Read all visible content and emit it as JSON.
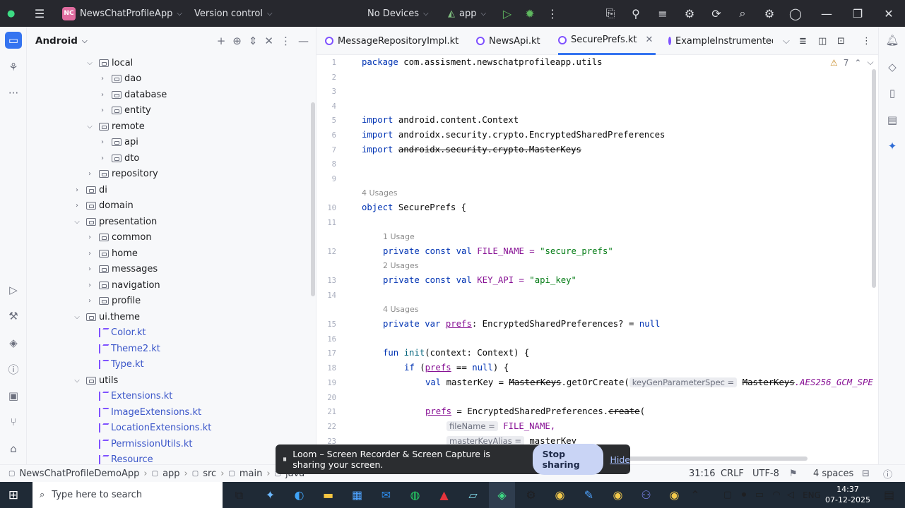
{
  "titlebar": {
    "project_badge": "NC",
    "project_name": "NewsChatProfileApp",
    "vcs": "Version control",
    "devices": "No Devices",
    "run_config": "app"
  },
  "project_panel": {
    "view_mode": "Android",
    "tree": [
      {
        "label": "local",
        "kind": "folder",
        "indent": 2,
        "state": "open",
        "row": 0
      },
      {
        "label": "dao",
        "kind": "folder",
        "indent": 3,
        "state": "closed",
        "row": 1
      },
      {
        "label": "database",
        "kind": "folder",
        "indent": 3,
        "state": "closed",
        "row": 2
      },
      {
        "label": "entity",
        "kind": "folder",
        "indent": 3,
        "state": "closed",
        "row": 3
      },
      {
        "label": "remote",
        "kind": "folder",
        "indent": 2,
        "state": "open",
        "row": 4
      },
      {
        "label": "api",
        "kind": "folder",
        "indent": 3,
        "state": "closed",
        "row": 5
      },
      {
        "label": "dto",
        "kind": "folder",
        "indent": 3,
        "state": "closed",
        "row": 6
      },
      {
        "label": "repository",
        "kind": "folder",
        "indent": 2,
        "state": "closed",
        "row": 7
      },
      {
        "label": "di",
        "kind": "folder",
        "indent": 1,
        "state": "closed",
        "row": 8
      },
      {
        "label": "domain",
        "kind": "folder",
        "indent": 1,
        "state": "closed",
        "row": 9
      },
      {
        "label": "presentation",
        "kind": "folder",
        "indent": 1,
        "state": "open",
        "row": 10
      },
      {
        "label": "common",
        "kind": "folder",
        "indent": 2,
        "state": "closed",
        "row": 11
      },
      {
        "label": "home",
        "kind": "folder",
        "indent": 2,
        "state": "closed",
        "row": 12
      },
      {
        "label": "messages",
        "kind": "folder",
        "indent": 2,
        "state": "closed",
        "row": 13
      },
      {
        "label": "navigation",
        "kind": "folder",
        "indent": 2,
        "state": "closed",
        "row": 14
      },
      {
        "label": "profile",
        "kind": "folder",
        "indent": 2,
        "state": "closed",
        "row": 15
      },
      {
        "label": "ui.theme",
        "kind": "folder",
        "indent": 1,
        "state": "open",
        "row": 16
      },
      {
        "label": "Color.kt",
        "kind": "kotlin",
        "indent": 2,
        "state": "none",
        "row": 17
      },
      {
        "label": "Theme2.kt",
        "kind": "kotlin",
        "indent": 2,
        "state": "none",
        "row": 18
      },
      {
        "label": "Type.kt",
        "kind": "kotlin",
        "indent": 2,
        "state": "none",
        "row": 19
      },
      {
        "label": "utils",
        "kind": "folder",
        "indent": 1,
        "state": "open",
        "row": 20
      },
      {
        "label": "Extensions.kt",
        "kind": "kotlin",
        "indent": 2,
        "state": "none",
        "row": 21
      },
      {
        "label": "ImageExtensions.kt",
        "kind": "kotlin",
        "indent": 2,
        "state": "none",
        "row": 22
      },
      {
        "label": "LocationExtensions.kt",
        "kind": "kotlin",
        "indent": 2,
        "state": "none",
        "row": 23
      },
      {
        "label": "PermissionUtils.kt",
        "kind": "kotlin",
        "indent": 2,
        "state": "none",
        "row": 24
      },
      {
        "label": "Resource",
        "kind": "kotlin",
        "indent": 2,
        "state": "none",
        "row": 25
      }
    ]
  },
  "editor": {
    "tabs": [
      {
        "label": "MessageRepositoryImpl.kt",
        "active": false
      },
      {
        "label": "NewsApi.kt",
        "active": false
      },
      {
        "label": "SecurePrefs.kt",
        "active": true
      },
      {
        "label": "ExampleInstrumented",
        "active": false
      }
    ],
    "warnings_count": "7",
    "line_numbers": [
      "1",
      "2",
      "3",
      "4",
      "5",
      "6",
      "7",
      "8",
      "9",
      "10",
      "11",
      "12",
      "13",
      "14",
      "15",
      "16",
      "17",
      "18",
      "19",
      "20",
      "21",
      "22",
      "23"
    ],
    "usages": {
      "object": "4 Usages",
      "file_name": "1 Usage",
      "key_api": "2 Usages",
      "prefs": "4 Usages"
    },
    "code": {
      "l1_kw": "package",
      "l1_rest": " com.assisment.newschatprofileapp.utils",
      "l5_kw": "import",
      "l5_rest": " android.content.Context",
      "l6_kw": "import",
      "l6_rest": " androidx.security.crypto.EncryptedSharedPreferences",
      "l7_kw": "import",
      "l7_rest": "androidx.security.crypto.MasterKeys",
      "l10_kw": "object",
      "l10_rest": " SecurePrefs {",
      "l12_kw": "private const val",
      "l12_name": " FILE_NAME = ",
      "l12_str": "\"secure_prefs\"",
      "l13_kw": "private const val",
      "l13_name": " KEY_API = ",
      "l13_str": "\"api_key\"",
      "l15_kw": "private var",
      "l15_prop": "prefs",
      "l15_rest": ": EncryptedSharedPreferences? = ",
      "l15_null": "null",
      "l17_kw": "fun",
      "l17_fn": "init",
      "l17_rest": "(context: Context) {",
      "l18_kw": "if",
      "l18_open": " (",
      "l18_prop": "prefs",
      "l18_mid": " == ",
      "l18_null": "null",
      "l18_end": ") {",
      "l19_kw": "val",
      "l19_rest": " masterKey = ",
      "l19_mk": "MasterKeys",
      "l19_call": ".getOrCreate(",
      "l19_hint": "keyGenParameterSpec =",
      "l19_mk2": "MasterKeys",
      "l19_cst": ".AES256_GCM_SPE",
      "l21_prop": "prefs",
      "l21_rest": " = EncryptedSharedPreferences.",
      "l21_fn": "create",
      "l21_end": "(",
      "l22_hint": "fileName =",
      "l22_rest": " FILE_NAME,",
      "l23_hint": "masterKeyAlias =",
      "l23_rest": " masterKey"
    }
  },
  "statusbar": {
    "breadcrumb": [
      "NewsChatProfileDemoApp",
      "app",
      "src",
      "main",
      "java"
    ],
    "position": "31:16",
    "line_sep": "CRLF",
    "encoding": "UTF-8",
    "indent": "4 spaces"
  },
  "loom": {
    "message": "Loom – Screen Recorder & Screen Capture is sharing your screen.",
    "stop": "Stop sharing",
    "hide": "Hide"
  },
  "taskbar": {
    "search_placeholder": "Type here to search",
    "language": "ENG",
    "time": "14:37",
    "date": "07-12-2025"
  },
  "colors": {
    "accent": "#3574f0",
    "titlebar_bg": "#27282e",
    "taskbar_bg": "#1f2a36",
    "keyword": "#0033b3",
    "string": "#067d17"
  }
}
